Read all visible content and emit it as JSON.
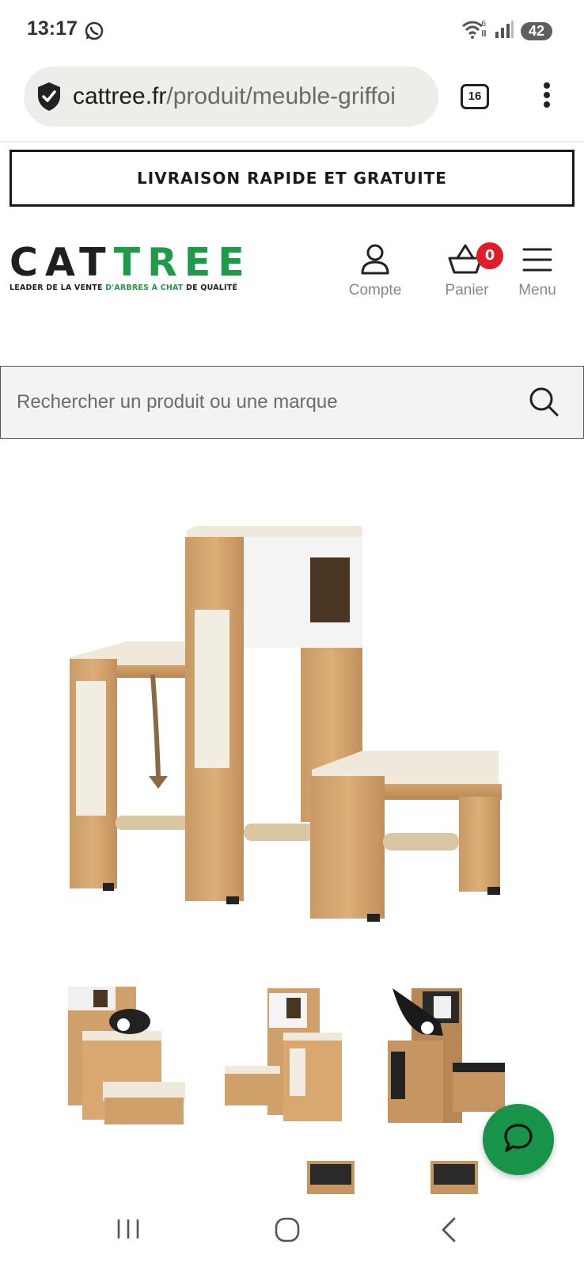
{
  "status_bar": {
    "time": "13:17",
    "battery": "42",
    "icons": [
      "whatsapp-icon",
      "wifi-icon",
      "signal-icon",
      "battery-icon"
    ]
  },
  "browser": {
    "url_domain": "cattree.fr",
    "url_path": "/produit/meuble-griffoi",
    "tab_count": "16"
  },
  "banner": {
    "text": "LIVRAISON RAPIDE ET GRATUITE"
  },
  "header": {
    "logo_cat": "CAT",
    "logo_tree": "TREE",
    "tagline_a": "LEADER DE LA VENTE ",
    "tagline_b": "D'ARBRES À CHAT",
    "tagline_c": " DE QUALITÉ",
    "account_label": "Compte",
    "cart_label": "Panier",
    "cart_count": "0",
    "menu_label": "Menu"
  },
  "search": {
    "placeholder": "Rechercher un produit ou une marque"
  },
  "colors": {
    "brand_green": "#1e9a4a",
    "cart_badge": "#e01b2a",
    "chat_fab": "#17944a"
  }
}
